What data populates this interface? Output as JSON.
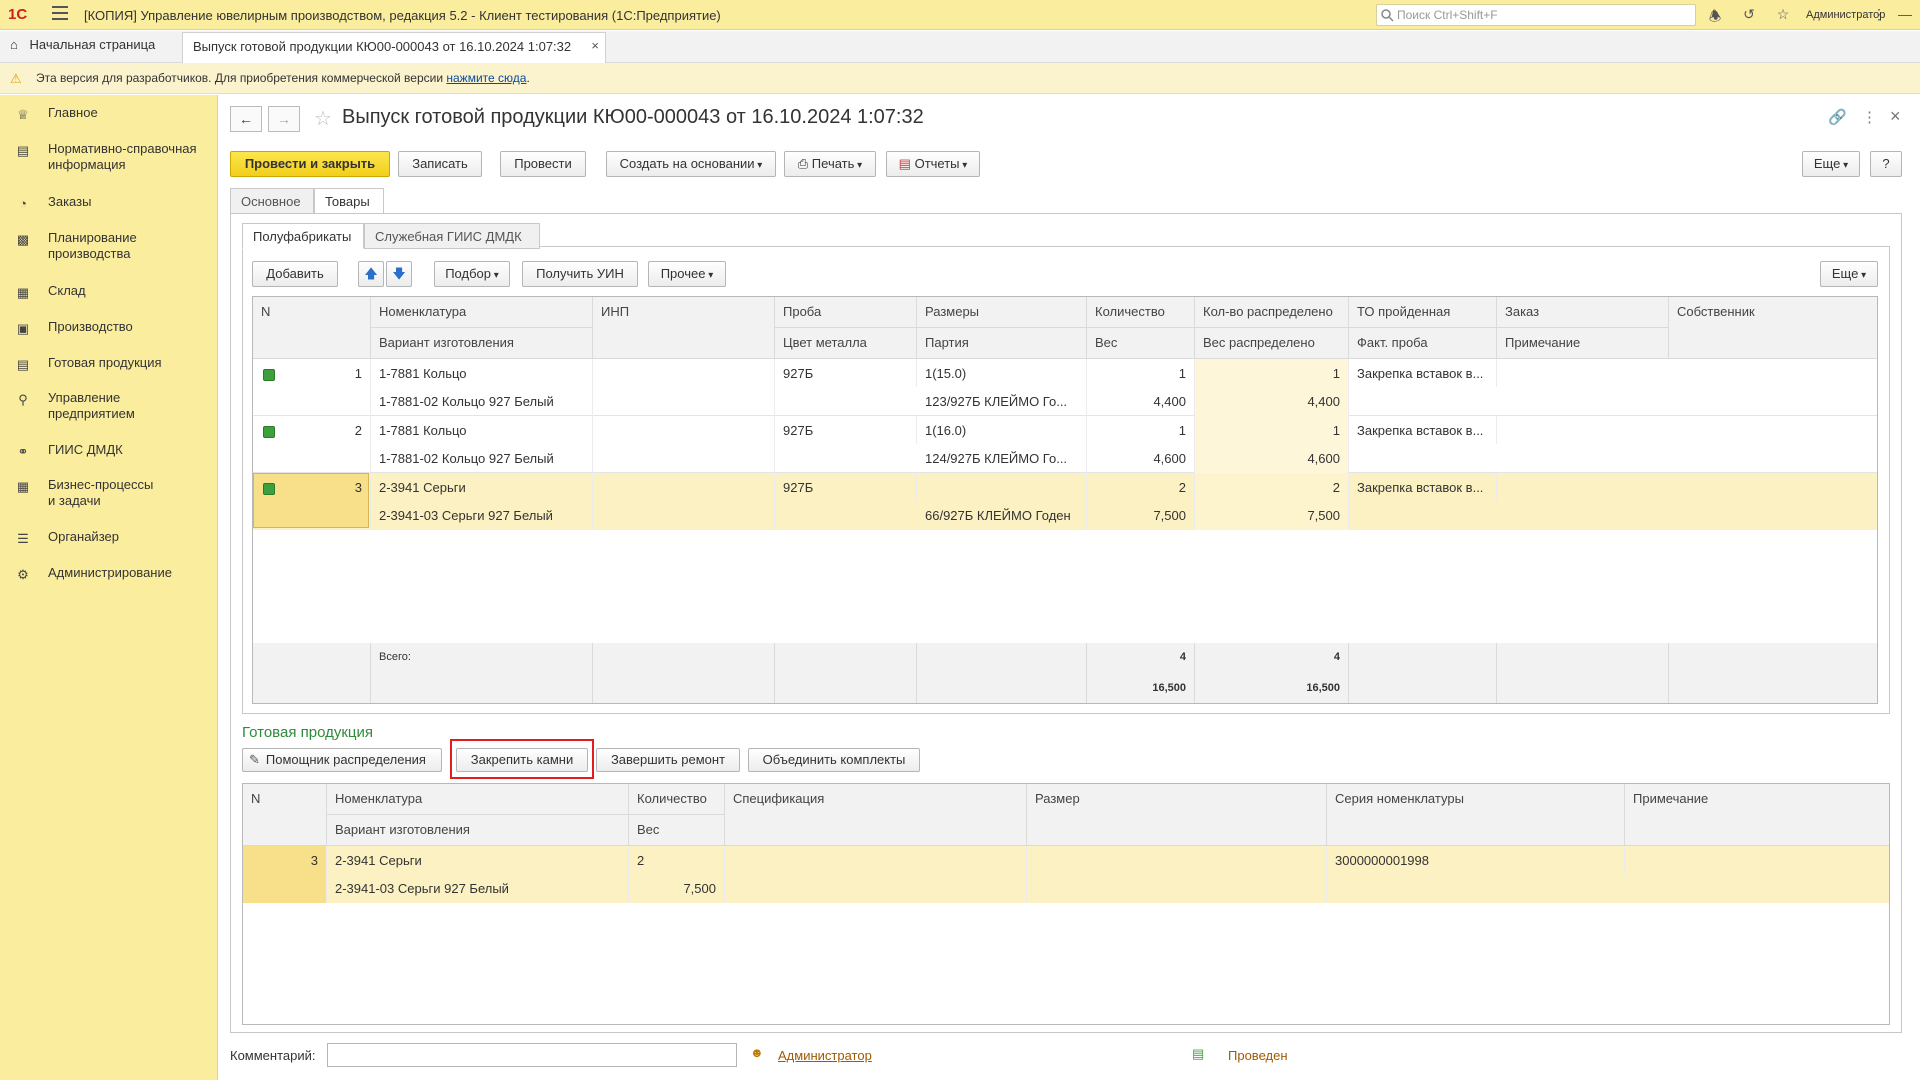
{
  "titlebar": {
    "logo": "1С",
    "title": "[КОПИЯ] Управление ювелирным производством, редакция 5.2  - Клиент тестирования (1С:Предприятие)",
    "search_placeholder": "Поиск Ctrl+Shift+F",
    "user": "Администратор"
  },
  "tabs": {
    "home": "Начальная страница",
    "document": "Выпуск готовой продукции КЮ00-000043 от 16.10.2024 1:07:32"
  },
  "notice": {
    "text": "Эта версия для разработчиков. Для приобретения коммерческой версии ",
    "link": "нажмите сюда",
    "tail": "."
  },
  "sidebar": {
    "items": [
      {
        "label": "Главное",
        "icon": "crown-icon"
      },
      {
        "label": "Нормативно-справочная\nинформация",
        "icon": "book-icon"
      },
      {
        "label": "Заказы",
        "icon": "pie-icon"
      },
      {
        "label": "Планирование\nпроизводства",
        "icon": "clipboard-icon"
      },
      {
        "label": "Склад",
        "icon": "grid-icon"
      },
      {
        "label": "Производство",
        "icon": "factory-icon"
      },
      {
        "label": "Готовая продукция",
        "icon": "bag-icon"
      },
      {
        "label": "Управление\nпредприятием",
        "icon": "org-icon"
      },
      {
        "label": "ГИИС ДМДК",
        "icon": "link-icon"
      },
      {
        "label": "Бизнес-процессы\nи задачи",
        "icon": "process-icon"
      },
      {
        "label": "Органайзер",
        "icon": "organizer-icon"
      },
      {
        "label": "Администрирование",
        "icon": "gear-icon"
      }
    ]
  },
  "form": {
    "title": "Выпуск готовой продукции КЮ00-000043 от 16.10.2024 1:07:32",
    "toolbar": {
      "post_close": "Провести и закрыть",
      "save": "Записать",
      "post": "Провести",
      "create_based": "Создать на основании",
      "print": "Печать",
      "reports": "Отчеты",
      "more": "Еще",
      "help": "?"
    },
    "tabs": [
      "Основное",
      "Товары"
    ],
    "subtabs": [
      "Полуфабрикаты",
      "Служебная ГИИС ДМДК"
    ],
    "sub_toolbar": {
      "add": "Добавить",
      "pick": "Подбор",
      "get_uin": "Получить УИН",
      "other": "Прочее",
      "more": "Еще"
    },
    "grid1": {
      "headers_top": [
        "N",
        "Номенклатура",
        "ИНП",
        "Проба",
        "Размеры",
        "Количество",
        "Кол-во распределено",
        "ТО пройденная",
        "Заказ",
        "Собственник"
      ],
      "headers_bottom": [
        "Вариант изготовления",
        "Цвет металла",
        "Партия",
        "Вес",
        "Вес распределено",
        "Факт. проба",
        "Примечание"
      ],
      "rows": [
        {
          "n": "1",
          "nom": "1-7881 Кольцо",
          "variant": "1-7881-02 Кольцо 927 Белый",
          "proba": "927Б",
          "size": "1(15.0)",
          "party": "123/927Б КЛЕЙМО Го...",
          "qty": "1",
          "weight": "4,400",
          "qty_dist": "1",
          "weight_dist": "4,400",
          "to": "Закрепка вставок в..."
        },
        {
          "n": "2",
          "nom": "1-7881 Кольцо",
          "variant": "1-7881-02 Кольцо 927 Белый",
          "proba": "927Б",
          "size": "1(16.0)",
          "party": "124/927Б КЛЕЙМО Го...",
          "qty": "1",
          "weight": "4,600",
          "qty_dist": "1",
          "weight_dist": "4,600",
          "to": "Закрепка вставок в..."
        },
        {
          "n": "3",
          "nom": "2-3941 Серьги",
          "variant": "2-3941-03 Серьги 927 Белый",
          "proba": "927Б",
          "size": "",
          "party": "66/927Б КЛЕЙМО Годен",
          "qty": "2",
          "weight": "7,500",
          "qty_dist": "2",
          "weight_dist": "7,500",
          "to": "Закрепка вставок в..."
        }
      ],
      "footer": {
        "label": "Всего:",
        "qty": "4",
        "qty_dist": "4",
        "weight": "16,500",
        "weight_dist": "16,500"
      }
    },
    "finished": {
      "caption": "Готовая продукция",
      "buttons": {
        "assistant": "Помощник распределения",
        "fix_stones": "Закрепить камни",
        "finish_repair": "Завершить ремонт",
        "combine": "Объединить комплекты"
      }
    },
    "grid2": {
      "headers_top": [
        "N",
        "Номенклатура",
        "Количество",
        "Спецификация",
        "Размер",
        "Серия номенклатуры",
        "Примечание"
      ],
      "headers_bottom": [
        "Вариант изготовления",
        "Вес"
      ],
      "rows": [
        {
          "n": "3",
          "nom": "2-3941 Серьги",
          "variant": "2-3941-03 Серьги 927 Белый",
          "qty": "2",
          "weight": "7,500",
          "series": "3000000001998"
        }
      ]
    },
    "bottom": {
      "comment_label": "Комментарий:",
      "comment_value": "",
      "author": "Администратор",
      "status": "Проведен"
    }
  }
}
